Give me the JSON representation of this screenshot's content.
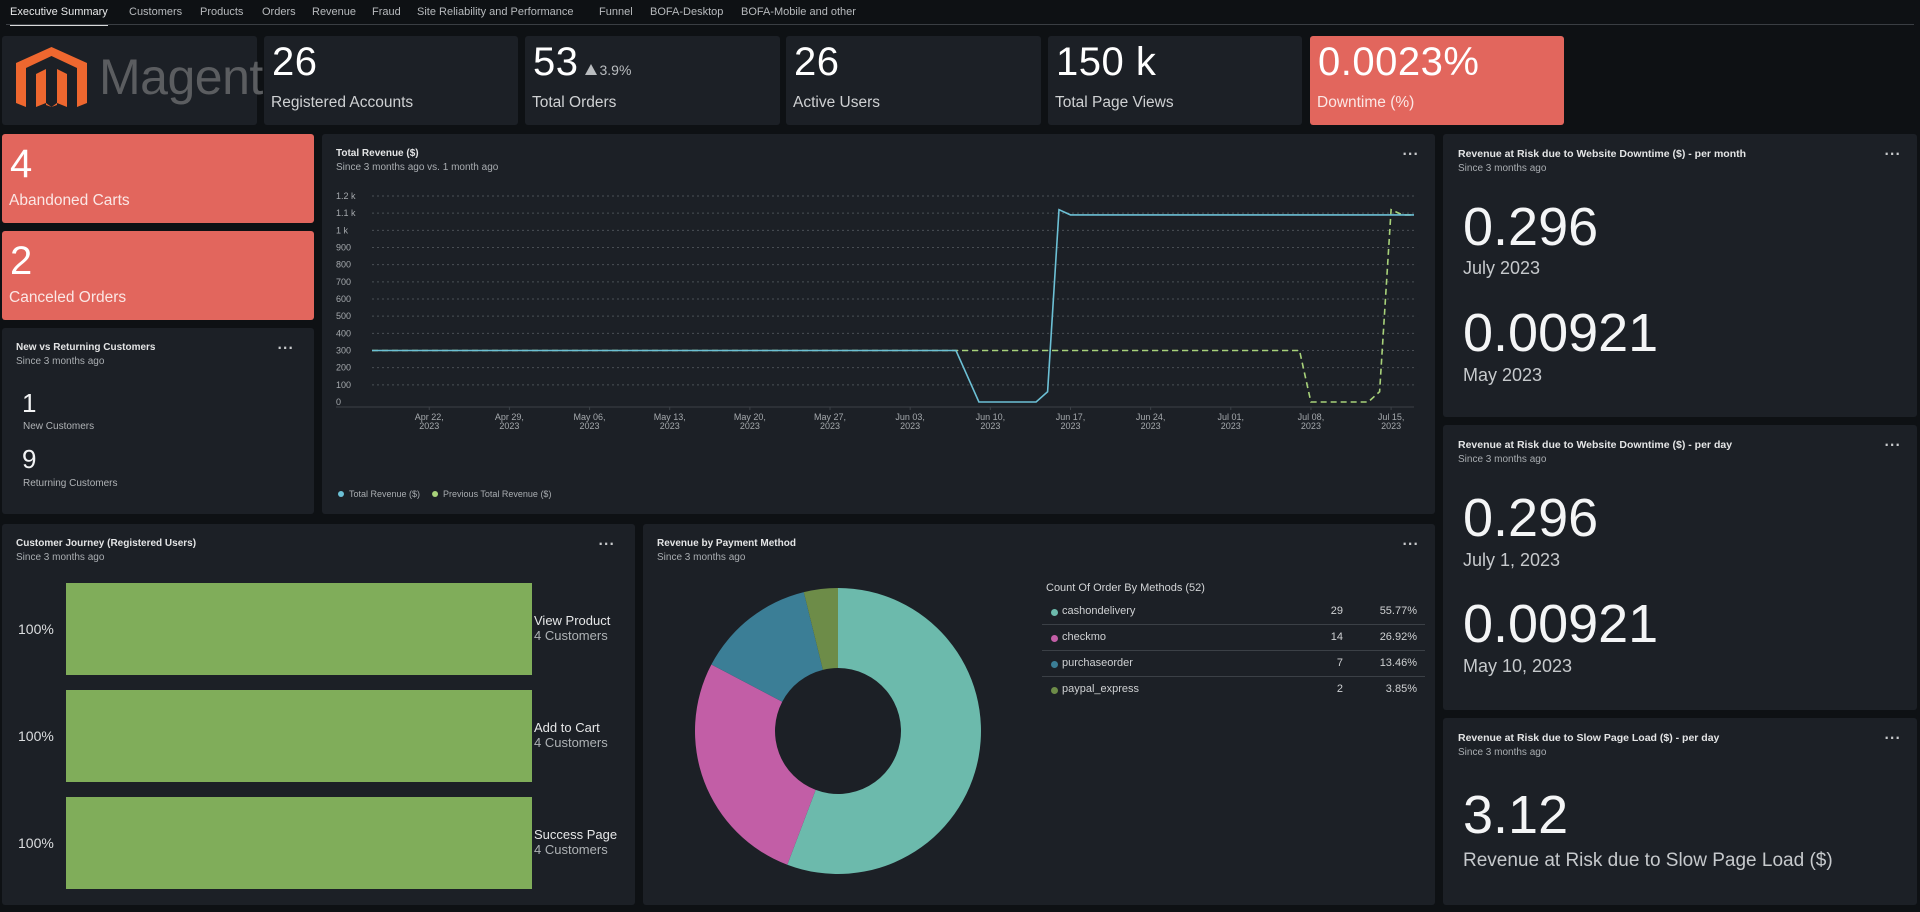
{
  "tabs": [
    {
      "label": "Executive Summary",
      "active": true
    },
    {
      "label": "Customers"
    },
    {
      "label": "Products"
    },
    {
      "label": "Orders"
    },
    {
      "label": "Revenue"
    },
    {
      "label": "Fraud"
    },
    {
      "label": "Site Reliability and Performance"
    },
    {
      "label": "Funnel"
    },
    {
      "label": "BOFA-Desktop"
    },
    {
      "label": "BOFA-Mobile and other"
    }
  ],
  "logo": {
    "text": "Magento",
    "reg": "®",
    "icon_color": "#ee672f",
    "text_color": "#5b5d60"
  },
  "kpis": {
    "registered_accounts": {
      "value": "26",
      "label": "Registered Accounts"
    },
    "total_orders": {
      "value": "53",
      "delta": "3.9%",
      "delta_direction": "up",
      "label": "Total Orders"
    },
    "active_users": {
      "value": "26",
      "label": "Active Users"
    },
    "total_page_views": {
      "value": "150 k",
      "label": "Total Page Views"
    },
    "downtime": {
      "value": "0.0023%",
      "label": "Downtime (%)"
    },
    "abandoned_carts": {
      "value": "4",
      "label": "Abandoned Carts"
    },
    "canceled_orders": {
      "value": "2",
      "label": "Canceled Orders"
    }
  },
  "colors": {
    "alert": "#e2665d",
    "panel": "#1c2026",
    "background": "#0e1114",
    "series_current": "#6cc0d5",
    "series_previous": "#a8d27a",
    "funnel": "#80ad5a"
  },
  "new_vs_returning": {
    "title": "New vs Returning Customers",
    "subtitle": "Since 3 months ago",
    "menu": "...",
    "new_value": "1",
    "new_label": "New Customers",
    "returning_value": "9",
    "returning_label": "Returning Customers"
  },
  "revenue_panel": {
    "title": "Total Revenue ($)",
    "subtitle": "Since 3 months ago vs. 1 month ago",
    "menu": "..."
  },
  "chart_data": [
    {
      "type": "line",
      "title": "Total Revenue ($)",
      "subtitle": "Since 3 months ago vs. 1 month ago",
      "xlabel": "",
      "ylabel": "",
      "ylim": [
        0,
        1200
      ],
      "yticks": [
        0,
        100,
        200,
        300,
        400,
        500,
        600,
        700,
        800,
        900,
        1000,
        1100,
        1200
      ],
      "ytick_labels": [
        "0",
        "100",
        "200",
        "300",
        "400",
        "500",
        "600",
        "700",
        "800",
        "900",
        "1 k",
        "1.1 k",
        "1.2 k"
      ],
      "xlim": [
        "2023-04-17",
        "2023-07-17"
      ],
      "xticks": [
        "2023-04-22",
        "2023-04-29",
        "2023-05-06",
        "2023-05-13",
        "2023-05-20",
        "2023-05-27",
        "2023-06-03",
        "2023-06-10",
        "2023-06-17",
        "2023-06-24",
        "2023-07-01",
        "2023-07-08",
        "2023-07-15"
      ],
      "xtick_labels": [
        [
          "Apr 22,",
          "2023"
        ],
        [
          "Apr 29,",
          "2023"
        ],
        [
          "May 06,",
          "2023"
        ],
        [
          "May 13,",
          "2023"
        ],
        [
          "May 20,",
          "2023"
        ],
        [
          "May 27,",
          "2023"
        ],
        [
          "Jun 03,",
          "2023"
        ],
        [
          "Jun 10,",
          "2023"
        ],
        [
          "Jun 17,",
          "2023"
        ],
        [
          "Jun 24,",
          "2023"
        ],
        [
          "Jul 01,",
          "2023"
        ],
        [
          "Jul 08,",
          "2023"
        ],
        [
          "Jul 15,",
          "2023"
        ]
      ],
      "grid": true,
      "legend": "bottom-left",
      "series": [
        {
          "name": "Total Revenue ($)",
          "style": "solid",
          "points": [
            [
              "2023-04-17",
              300
            ],
            [
              "2023-06-07",
              300
            ],
            [
              "2023-06-09",
              0
            ],
            [
              "2023-06-14",
              0
            ],
            [
              "2023-06-15",
              60
            ],
            [
              "2023-06-16",
              1120
            ],
            [
              "2023-06-17",
              1090
            ],
            [
              "2023-07-17",
              1090
            ]
          ]
        },
        {
          "name": "Previous Total Revenue ($)",
          "style": "dashed",
          "points": [
            [
              "2023-04-17",
              300
            ],
            [
              "2023-07-07",
              300
            ],
            [
              "2023-07-08",
              0
            ],
            [
              "2023-07-13",
              0
            ],
            [
              "2023-07-14",
              60
            ],
            [
              "2023-07-15",
              1120
            ],
            [
              "2023-07-16",
              1090
            ],
            [
              "2023-07-17",
              1090
            ]
          ]
        }
      ]
    },
    {
      "type": "pie",
      "title": "Revenue by Payment Method",
      "subtitle": "Since 3 months ago",
      "donut": true,
      "legend_title": "Count Of Order By Methods (52)",
      "legend": "right",
      "slices": [
        {
          "label": "cashondelivery",
          "value": 29,
          "percent": "55.77%",
          "color": "#6cbaac"
        },
        {
          "label": "checkmo",
          "value": 14,
          "percent": "26.92%",
          "color": "#c25ea6"
        },
        {
          "label": "purchaseorder",
          "value": 7,
          "percent": "13.46%",
          "color": "#3b7e96"
        },
        {
          "label": "paypal_express",
          "value": 2,
          "percent": "3.85%",
          "color": "#6d8c48"
        }
      ]
    },
    {
      "type": "bar",
      "title": "Customer Journey (Registered Users)",
      "subtitle": "Since 3 months ago",
      "orientation": "horizontal",
      "categories": [
        "View Product",
        "Add to Cart",
        "Success Page"
      ],
      "values": [
        100,
        100,
        100
      ],
      "value_labels": [
        "100%",
        "100%",
        "100%"
      ],
      "counts": [
        "4 Customers",
        "4 Customers",
        "4 Customers"
      ],
      "xlim": [
        0,
        100
      ]
    }
  ],
  "journey": {
    "title": "Customer Journey (Registered Users)",
    "subtitle": "Since 3 months ago",
    "menu": "..."
  },
  "payment": {
    "title": "Revenue by Payment Method",
    "subtitle": "Since 3 months ago",
    "menu": "..."
  },
  "risk_month": {
    "title": "Revenue at Risk due to Website Downtime ($) - per month",
    "subtitle": "Since 3 months ago",
    "menu": "...",
    "items": [
      {
        "value": "0.296",
        "label": "July 2023"
      },
      {
        "value": "0.00921",
        "label": "May 2023"
      }
    ]
  },
  "risk_day": {
    "title": "Revenue at Risk due to Website Downtime ($) - per day",
    "subtitle": "Since 3 months ago",
    "menu": "...",
    "items": [
      {
        "value": "0.296",
        "label": "July 1, 2023"
      },
      {
        "value": "0.00921",
        "label": "May 10, 2023"
      }
    ]
  },
  "risk_slow": {
    "title": "Revenue at Risk due to Slow Page Load ($) - per day",
    "subtitle": "Since 3 months ago",
    "menu": "...",
    "value": "3.12",
    "label": "Revenue at Risk due to Slow Page Load ($)"
  }
}
